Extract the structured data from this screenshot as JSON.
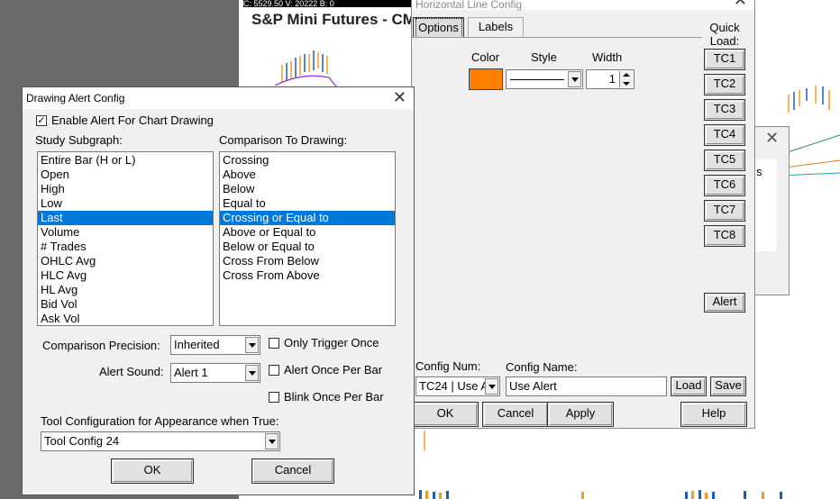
{
  "chart": {
    "topbar_text": "C: 5529.50 V: 20222 B: 0",
    "title": "S&P Mini Futures - CM"
  },
  "horizontal_line_config": {
    "title": "Horizontal Line Config",
    "tabs": [
      {
        "label": "Options",
        "active": true
      },
      {
        "label": "Labels",
        "active": false
      }
    ],
    "color_label": "Color",
    "color_value": "#ff8000",
    "style_label": "Style",
    "width_label": "Width",
    "width_value": "1",
    "quick_load_label": "Quick\nLoad:",
    "quick_load_buttons": [
      "TC1",
      "TC2",
      "TC3",
      "TC4",
      "TC5",
      "TC6",
      "TC7",
      "TC8"
    ],
    "alert_button": "Alert",
    "config_num_label": "Config Num:",
    "config_num_value": "TC24 | Use A",
    "config_name_label": "Config Name:",
    "config_name_value": "Use Alert",
    "load_button": "Load",
    "save_button": "Save",
    "ok_button": "OK",
    "cancel_button": "Cancel",
    "apply_button": "Apply",
    "help_button": "Help"
  },
  "drawing_alert_config": {
    "title": "Drawing Alert Config",
    "enable_alert_label": "Enable Alert For Chart Drawing",
    "enable_alert_checked": true,
    "study_subgraph_label": "Study Subgraph:",
    "study_subgraph_items": [
      "Entire Bar (H or L)",
      "Open",
      "High",
      "Low",
      "Last",
      "Volume",
      "# Trades",
      "OHLC Avg",
      "HLC Avg",
      "HL Avg",
      "Bid Vol",
      "Ask Vol"
    ],
    "study_subgraph_selected": 4,
    "comparison_label": "Comparison To Drawing:",
    "comparison_items": [
      "Crossing",
      "Above",
      "Below",
      "Equal to",
      "Crossing or Equal to",
      "Above or Equal to",
      "Below or Equal to",
      "Cross From Below",
      "Cross From Above"
    ],
    "comparison_selected": 4,
    "comparison_precision_label": "Comparison Precision:",
    "comparison_precision_value": "Inherited",
    "alert_sound_label": "Alert Sound:",
    "alert_sound_value": "Alert 1",
    "only_trigger_once_label": "Only Trigger Once",
    "alert_once_per_bar_label": "Alert Once Per Bar",
    "blink_once_per_bar_label": "Blink Once Per Bar",
    "tool_config_label": "Tool Configuration for Appearance when True:",
    "tool_config_value": "Tool Config 24",
    "ok_button": "OK",
    "cancel_button": "Cancel"
  },
  "background_dialog": {
    "partial_text": "s"
  }
}
